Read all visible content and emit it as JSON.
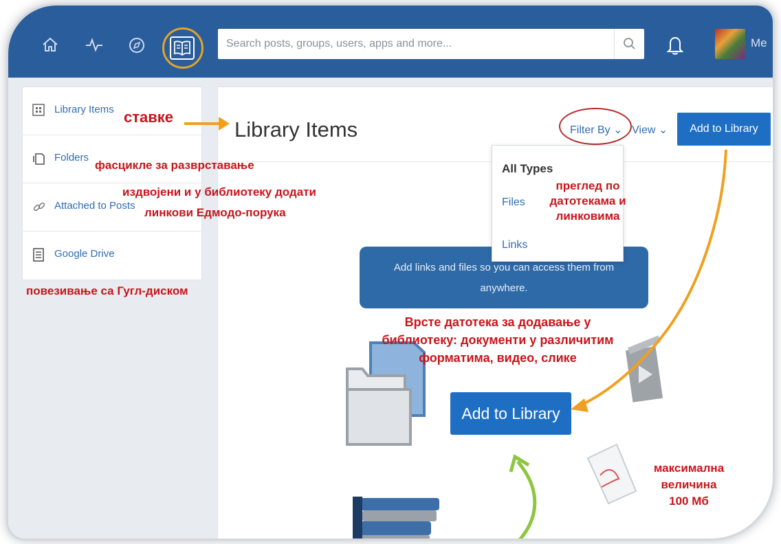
{
  "topbar": {
    "nav_icons": [
      "home-icon",
      "activity-icon",
      "compass-icon",
      "library-book-icon"
    ],
    "search_placeholder": "Search posts, groups, users, apps and more...",
    "search_icon": "search-icon",
    "notification_icon": "bell-icon",
    "user_label": "Me"
  },
  "sidebar": {
    "items": [
      {
        "label": "Library Items",
        "icon": "grid-icon"
      },
      {
        "label": "Folders",
        "icon": "folders-icon"
      },
      {
        "label": "Attached to Posts",
        "icon": "link-icon"
      },
      {
        "label": "Google Drive",
        "icon": "document-icon"
      }
    ]
  },
  "main": {
    "title": "Library Items",
    "filter_label": "Filter By",
    "view_label": "View",
    "add_button_label": "Add to Library",
    "filter_menu": {
      "heading": "All Types",
      "options": [
        "Files",
        "Links"
      ]
    },
    "banner_text_line1": "Add links and files so you can access them from",
    "banner_text_line2": "anywhere.",
    "big_add_button_label": "Add to Library"
  },
  "annotations": {
    "library_items": "ставке",
    "folders": "фасцикле за разврставање",
    "attached_line1": "издвојени и у библиотеку додати",
    "attached_line2": "линкови Едмодо-порука",
    "google_drive": "повезивање са Гугл-диском",
    "filter_line1": "преглед по",
    "filter_line2": "датотекама и",
    "filter_line3": "линковима",
    "types_line1": "Врсте датотека за додавање у",
    "types_line2": "библиотеку: документи у различитим",
    "types_line3": "форматима, видео, слике",
    "size_line1": "максимална",
    "size_line2": "величина",
    "size_line3": "100 Мб"
  },
  "colors": {
    "topbar": "#2a5d9b",
    "accent_button": "#1e6fc4",
    "link": "#2f6db5",
    "annotation_red": "#c8141a",
    "arrow_orange": "#f0a020",
    "arrow_green": "#8dc63f"
  }
}
